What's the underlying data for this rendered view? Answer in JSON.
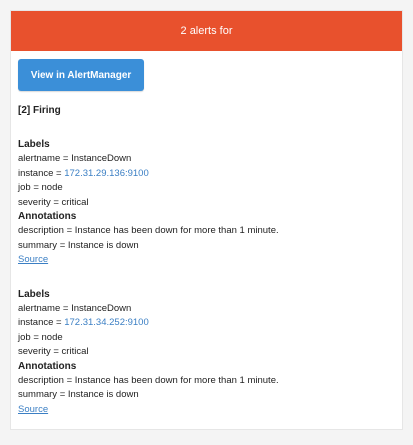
{
  "header": {
    "title": "2 alerts for"
  },
  "button": {
    "label": "View in AlertManager"
  },
  "status": "[2] Firing",
  "alerts": [
    {
      "labels_title": "Labels",
      "alertname": "alertname = InstanceDown",
      "instance_prefix": "instance = ",
      "instance_value": "172.31.29.136:9100",
      "job": "job = node",
      "severity": "severity = critical",
      "annotations_title": "Annotations",
      "description": "description = Instance has been down for more than 1 minute.",
      "summary": "summary = Instance is down",
      "source": "Source"
    },
    {
      "labels_title": "Labels",
      "alertname": "alertname = InstanceDown",
      "instance_prefix": "instance = ",
      "instance_value": "172.31.34.252:9100",
      "job": "job = node",
      "severity": "severity = critical",
      "annotations_title": "Annotations",
      "description": "description = Instance has been down for more than 1 minute.",
      "summary": "summary = Instance is down",
      "source": "Source"
    }
  ],
  "colors": {
    "header": "#e8512d",
    "button": "#3b8fd8",
    "link": "#3b7fc4"
  }
}
